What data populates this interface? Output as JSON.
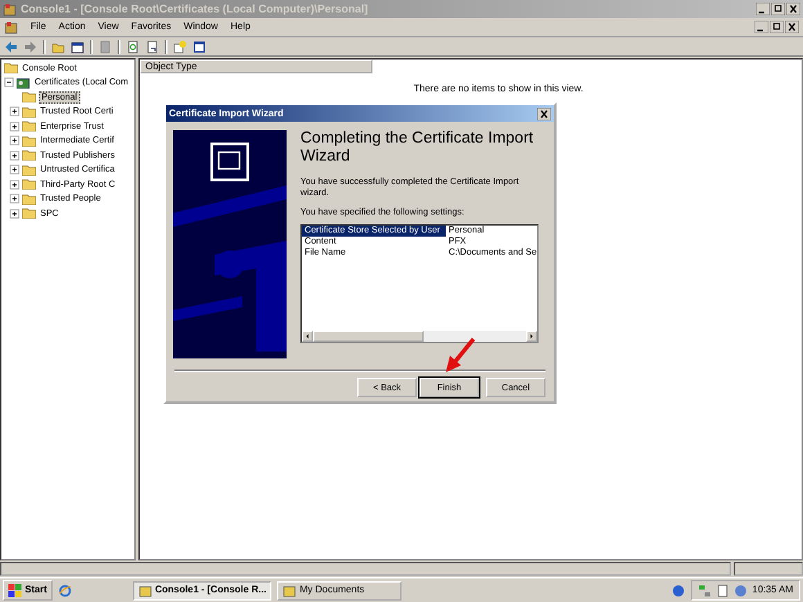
{
  "window": {
    "title": "Console1 - [Console Root\\Certificates (Local Computer)\\Personal]"
  },
  "menu": [
    "File",
    "Action",
    "View",
    "Favorites",
    "Window",
    "Help"
  ],
  "tree": {
    "label": "Console Root",
    "children": [
      {
        "label": "Certificates (Local Com",
        "expanded": true,
        "children": [
          {
            "label": "Personal",
            "selected": true
          },
          {
            "label": "Trusted Root Certi",
            "selected": false
          },
          {
            "label": "Enterprise Trust",
            "selected": false
          },
          {
            "label": "Intermediate Certif",
            "selected": false
          },
          {
            "label": "Trusted Publishers",
            "selected": false
          },
          {
            "label": "Untrusted Certifica",
            "selected": false
          },
          {
            "label": "Third-Party Root C",
            "selected": false
          },
          {
            "label": "Trusted People",
            "selected": false
          },
          {
            "label": "SPC",
            "selected": false
          }
        ]
      }
    ]
  },
  "list": {
    "columns": [
      "Object Type"
    ],
    "empty_message": "There are no items to show in this view."
  },
  "dialog": {
    "title": "Certificate Import Wizard",
    "heading": "Completing the Certificate Import Wizard",
    "message": "You have successfully completed the Certificate Import wizard.",
    "settings_label": "You have specified the following settings:",
    "settings": [
      {
        "setting": "Certificate Store Selected by User",
        "value": "Personal",
        "selected": true
      },
      {
        "setting": "Content",
        "value": "PFX",
        "selected": false
      },
      {
        "setting": "File Name",
        "value": "C:\\Documents and Se",
        "selected": false
      }
    ],
    "buttons": [
      {
        "label": "< Back",
        "default": false
      },
      {
        "label": "Finish",
        "default": true
      },
      {
        "label": "Cancel",
        "default": false
      }
    ]
  },
  "taskbar": {
    "start": "Start",
    "tasks": [
      {
        "label": "Console1 - [Console R...",
        "active": true
      },
      {
        "label": "My Documents",
        "active": false
      }
    ],
    "clock": "10:35 AM"
  }
}
